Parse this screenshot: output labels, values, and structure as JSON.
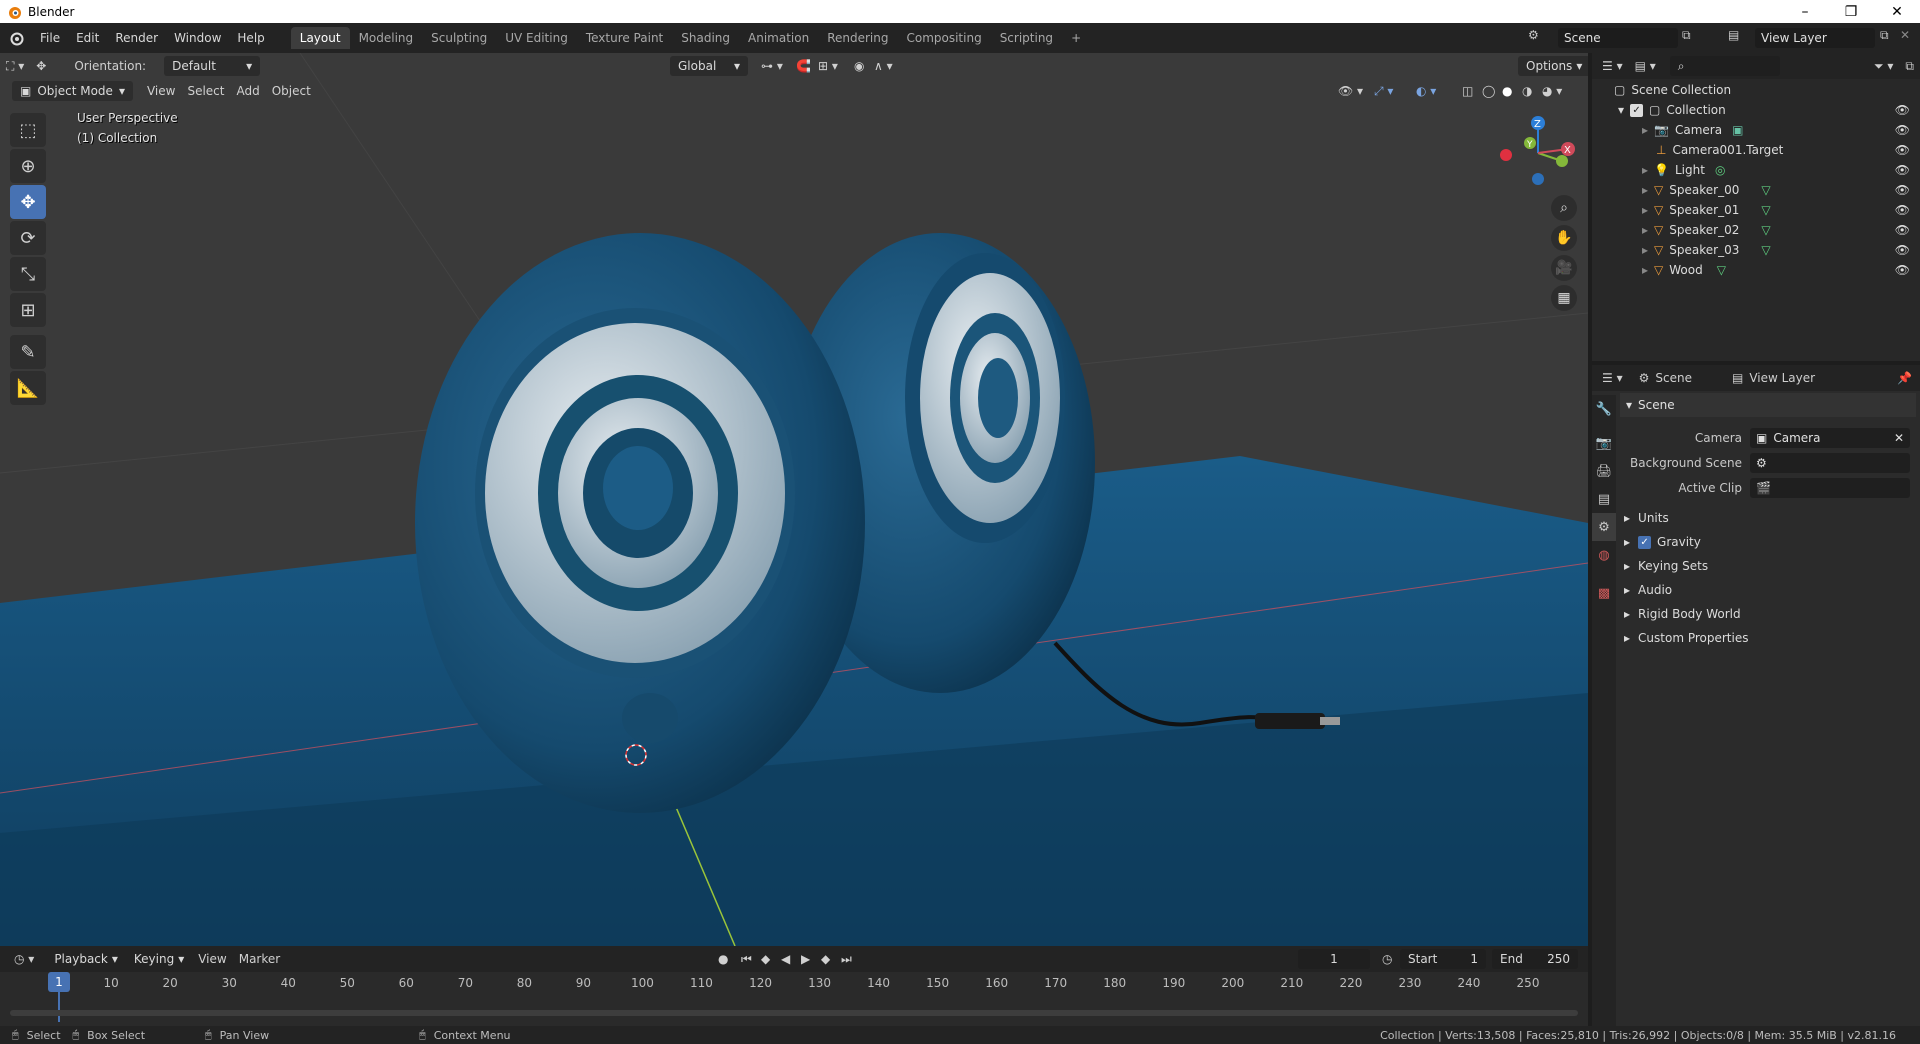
{
  "window": {
    "title": "Blender",
    "minimize": "–",
    "restore": "❐",
    "close": "✕"
  },
  "menu": [
    "File",
    "Edit",
    "Render",
    "Window",
    "Help"
  ],
  "workspaces": [
    "Layout",
    "Modeling",
    "Sculpting",
    "UV Editing",
    "Texture Paint",
    "Shading",
    "Animation",
    "Rendering",
    "Compositing",
    "Scripting",
    "+"
  ],
  "active_workspace": "Layout",
  "scene_selector": "Scene",
  "view_layer_selector": "View Layer",
  "viewport": {
    "orientation_label": "Orientation:",
    "orientation_value": "Default",
    "transform_orientation": "Global",
    "options_label": "Options",
    "mode": "Object Mode",
    "header_menu": [
      "View",
      "Select",
      "Add",
      "Object"
    ],
    "overlay_line1": "User Perspective",
    "overlay_line2": "(1) Collection"
  },
  "timeline": {
    "menu": [
      "Playback",
      "Keying",
      "View",
      "Marker"
    ],
    "current_frame": "1",
    "start_label": "Start",
    "start_value": "1",
    "end_label": "End",
    "end_value": "250",
    "ticks": [
      "1",
      "10",
      "20",
      "30",
      "40",
      "50",
      "60",
      "70",
      "80",
      "90",
      "100",
      "110",
      "120",
      "130",
      "140",
      "150",
      "160",
      "170",
      "180",
      "190",
      "200",
      "210",
      "220",
      "230",
      "240",
      "250"
    ]
  },
  "statusbar": {
    "select": "Select",
    "box_select": "Box Select",
    "pan_view": "Pan View",
    "context_menu": "Context Menu",
    "stats": "Collection | Verts:13,508 | Faces:25,810 | Tris:26,992 | Objects:0/8 | Mem: 35.5 MiB | v2.81.16"
  },
  "outliner": {
    "root": "Scene Collection",
    "collection": "Collection",
    "items": [
      {
        "name": "Camera",
        "icon": "camera-icon"
      },
      {
        "name": "Camera001.Target",
        "icon": "empty-icon"
      },
      {
        "name": "Light",
        "icon": "light-icon"
      },
      {
        "name": "Speaker_00",
        "icon": "mesh-icon"
      },
      {
        "name": "Speaker_01",
        "icon": "mesh-icon"
      },
      {
        "name": "Speaker_02",
        "icon": "mesh-icon"
      },
      {
        "name": "Speaker_03",
        "icon": "mesh-icon"
      },
      {
        "name": "Wood",
        "icon": "mesh-icon"
      }
    ]
  },
  "properties": {
    "breadcrumb_scene": "Scene",
    "breadcrumb_view_layer": "View Layer",
    "panel_title": "Scene",
    "camera_label": "Camera",
    "camera_value": "Camera",
    "background_scene_label": "Background Scene",
    "active_clip_label": "Active Clip",
    "subpanels": [
      "Units",
      "Gravity",
      "Keying Sets",
      "Audio",
      "Rigid Body World",
      "Custom Properties"
    ]
  },
  "colors": {
    "accent": "#4772b3",
    "scene_blue": "#134a6e",
    "grid_bg": "#3a3a3a"
  }
}
